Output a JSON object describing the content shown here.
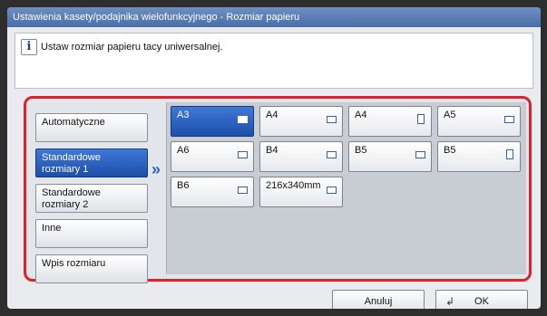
{
  "window": {
    "title": "Ustawienia kasety/podajnika wielofunkcyjnego - Rozmiar papieru"
  },
  "message": {
    "icon": "info-icon",
    "text": "Ustaw rozmiar papieru tacy uniwersalnej."
  },
  "categories": [
    {
      "label": "Automatyczne",
      "selected": false
    },
    {
      "label": "Standardowe rozmiary 1",
      "selected": true
    },
    {
      "label": "Standardowe rozmiary 2",
      "selected": false
    },
    {
      "label": "Inne",
      "selected": false
    },
    {
      "label": "Wpis rozmiaru",
      "selected": false
    }
  ],
  "paper_sizes": [
    {
      "label": "A3",
      "orientation": "landscape",
      "selected": true
    },
    {
      "label": "A4",
      "orientation": "landscape",
      "selected": false
    },
    {
      "label": "A4",
      "orientation": "portrait",
      "selected": false
    },
    {
      "label": "A5",
      "orientation": "landscape",
      "selected": false
    },
    {
      "label": "A6",
      "orientation": "landscape",
      "selected": false
    },
    {
      "label": "B4",
      "orientation": "landscape",
      "selected": false
    },
    {
      "label": "B5",
      "orientation": "landscape",
      "selected": false
    },
    {
      "label": "B5",
      "orientation": "portrait",
      "selected": false
    },
    {
      "label": "B6",
      "orientation": "landscape",
      "selected": false
    },
    {
      "label": "216x340mm",
      "orientation": "landscape",
      "selected": false
    }
  ],
  "footer": {
    "cancel_label": "Anuluj",
    "ok_label": "OK"
  },
  "colors": {
    "accent": "#1d4fa8",
    "highlight": "#e0202a",
    "title": "#4a6ea8"
  }
}
